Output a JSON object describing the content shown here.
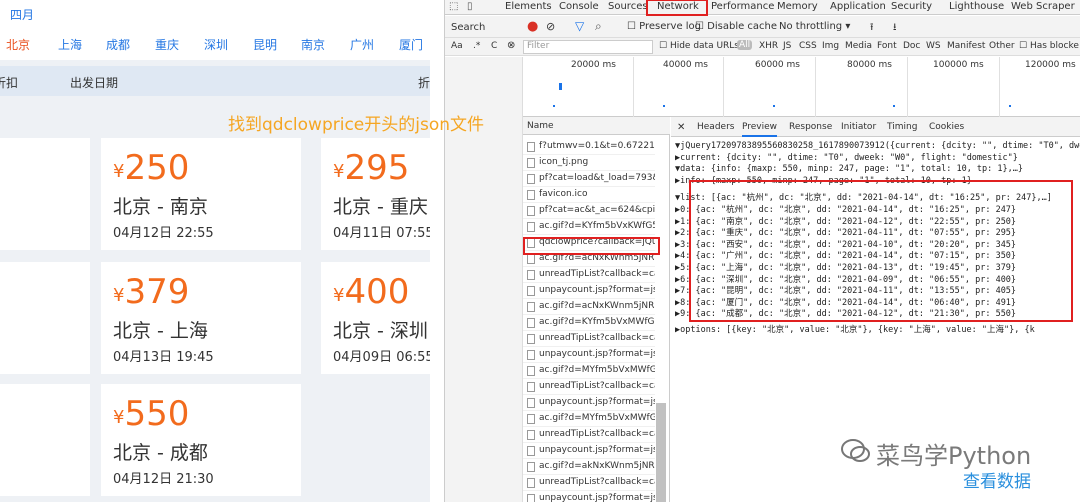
{
  "left_page": {
    "month": "四月",
    "cities": [
      {
        "label": "北京",
        "active": true
      },
      {
        "label": "上海",
        "active": false
      },
      {
        "label": "成都",
        "active": false
      },
      {
        "label": "重庆",
        "active": false
      },
      {
        "label": "深圳",
        "active": false
      },
      {
        "label": "昆明",
        "active": false
      },
      {
        "label": "南京",
        "active": false
      },
      {
        "label": "广州",
        "active": false
      },
      {
        "label": "厦门",
        "active": false
      }
    ],
    "sort_bar": {
      "discount": "折扣",
      "date": "出发日期",
      "right": "折"
    },
    "hint": "找到qdclowprice开头的json文件",
    "cards": [
      {
        "currency": "¥",
        "price": "250",
        "route": "北京 - 南京",
        "date": "04月12日  22:55"
      },
      {
        "currency": "¥",
        "price": "295",
        "route": "北京 - 重庆",
        "date": "04月11日  07:55"
      },
      {
        "currency": "¥",
        "price": "379",
        "route": "北京 - 上海",
        "date": "04月13日  19:45"
      },
      {
        "currency": "¥",
        "price": "400",
        "route": "北京 - 深圳",
        "date": "04月09日  06:55"
      },
      {
        "currency": "¥",
        "price": "550",
        "route": "北京 - 成都",
        "date": "04月12日  21:30"
      }
    ]
  },
  "devtools": {
    "tabs": [
      "Elements",
      "Console",
      "Sources",
      "Network",
      "Performance",
      "Memory",
      "Application",
      "Security",
      "Lighthouse",
      "Web Scraper"
    ],
    "active_tab": "Network",
    "toolbar": {
      "search": "Search",
      "preserve_log": "Preserve log",
      "disable_cache": "Disable cache",
      "throttling": "No throttling"
    },
    "filter": {
      "placeholder": "Filter",
      "hide_data_urls": "Hide data URLs",
      "types": [
        "All",
        "XHR",
        "JS",
        "CSS",
        "Img",
        "Media",
        "Font",
        "Doc",
        "WS",
        "Manifest",
        "Other"
      ],
      "blocked": "Has blocke"
    },
    "timeline_ticks": [
      "20000 ms",
      "40000 ms",
      "60000 ms",
      "80000 ms",
      "100000 ms",
      "120000 ms"
    ],
    "name_header": "Name",
    "requests": [
      "f?utmwv=0.1&t=0.6722195",
      "icon_tj.png",
      "pf?cat=load&t_load=793&c",
      "favicon.ico",
      "pf?cat=ac&t_ac=624&cpid=",
      "ac.gif?d=KYfm5bVxKWfG53",
      "qdclowprice?callback=jQuer",
      "ac.gif?d=acNxKWnm5jNRKV",
      "unreadTipList?callback=callb",
      "unpaycount.jsp?format=js&",
      "ac.gif?d=acNxKWnm5jNRKV",
      "ac.gif?d=KYfm5bVxMWfG5z",
      "unreadTipList?callback=callb",
      "unpaycount.jsp?format=js&",
      "ac.gif?d=MYfm5bVxMWfG5t",
      "unreadTipList?callback=callb",
      "unpaycount.jsp?format=js&",
      "ac.gif?d=MYfm5bVxMWfG5t",
      "unreadTipList?callback=callb",
      "unpaycount.jsp?format=js&",
      "ac.gif?d=akNxKWnm5jNRKV",
      "unreadTipList?callback=callb",
      "unpaycount.jsp?format=js&"
    ],
    "selected_request": "qdclowprice?callback=jQuer",
    "detail_tabs": [
      "Headers",
      "Preview",
      "Response",
      "Initiator",
      "Timing",
      "Cookies"
    ],
    "active_detail_tab": "Preview",
    "preview_lines": [
      "▼jQuery17209783895560830258_1617890073912({current: {dcity: \"\", dtime: \"T0\", dwe",
      "  ▶current: {dcity: \"\", dtime: \"T0\", dweek: \"W0\", flight: \"domestic\"}",
      "  ▼data: {info: {maxp: 550, minp: 247, page: \"1\", total: 10, tp: 1},…}",
      "    ▶info: {maxp: 550, minp: 247, page: \"1\", total: 10, tp: 1}",
      "    ▼list: [{ac: \"杭州\", dc: \"北京\", dd: \"2021-04-14\", dt: \"16:25\", pr: 247},…]",
      "      ▶0: {ac: \"杭州\", dc: \"北京\", dd: \"2021-04-14\", dt: \"16:25\", pr: 247}",
      "      ▶1: {ac: \"南京\", dc: \"北京\", dd: \"2021-04-12\", dt: \"22:55\", pr: 250}",
      "      ▶2: {ac: \"重庆\", dc: \"北京\", dd: \"2021-04-11\", dt: \"07:55\", pr: 295}",
      "      ▶3: {ac: \"西安\", dc: \"北京\", dd: \"2021-04-10\", dt: \"20:20\", pr: 345}",
      "      ▶4: {ac: \"广州\", dc: \"北京\", dd: \"2021-04-14\", dt: \"07:15\", pr: 350}",
      "      ▶5: {ac: \"上海\", dc: \"北京\", dd: \"2021-04-13\", dt: \"19:45\", pr: 379}",
      "      ▶6: {ac: \"深圳\", dc: \"北京\", dd: \"2021-04-09\", dt: \"06:55\", pr: 400}",
      "      ▶7: {ac: \"昆明\", dc: \"北京\", dd: \"2021-04-11\", dt: \"13:55\", pr: 405}",
      "      ▶8: {ac: \"厦门\", dc: \"北京\", dd: \"2021-04-14\", dt: \"06:40\", pr: 491}",
      "      ▶9: {ac: \"成都\", dc: \"北京\", dd: \"2021-04-12\", dt: \"21:30\", pr: 550}",
      "  ▶options: [{key: \"北京\", value: \"北京\"}, {key: \"上海\", value: \"上海\"}, {k"
    ],
    "annotation": "查看数据",
    "watermark": "菜鸟学Python"
  }
}
